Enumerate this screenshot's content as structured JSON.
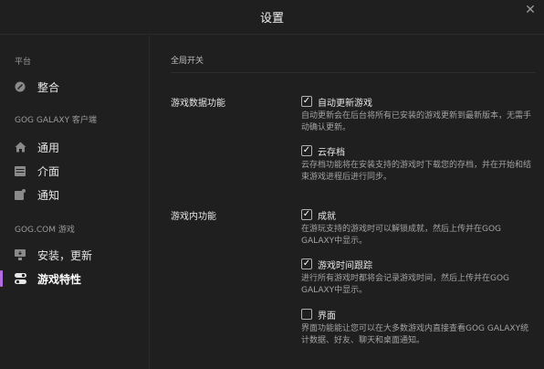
{
  "window": {
    "title": "设置",
    "close_icon": "close-icon"
  },
  "sidebar": {
    "sections": [
      {
        "header": "平台",
        "items": [
          {
            "label": "整合",
            "icon": "integration-icon"
          }
        ]
      },
      {
        "header": "GOG GALAXY 客户端",
        "items": [
          {
            "label": "通用",
            "icon": "home-icon"
          },
          {
            "label": "介面",
            "icon": "interface-icon"
          },
          {
            "label": "通知",
            "icon": "notification-icon"
          }
        ]
      },
      {
        "header": "GOG.COM 游戏",
        "items": [
          {
            "label": "安装，更新",
            "icon": "install-update-icon"
          },
          {
            "label": "游戏特性",
            "icon": "game-features-icon",
            "active": true
          }
        ]
      }
    ],
    "accent_color": "#b26be0"
  },
  "main": {
    "header": "全局开关",
    "groups": [
      {
        "label": "游戏数据功能",
        "options": [
          {
            "label": "自动更新游戏",
            "checked": true,
            "description": "自动更新会在后台将所有已安装的游戏更新到最新版本，无需手动确认更新。"
          },
          {
            "label": "云存档",
            "checked": true,
            "description": "云存档功能将在安装支持的游戏时下载您的存档，并在开始和结束游戏进程后进行同步。"
          }
        ]
      },
      {
        "label": "游戏内功能",
        "options": [
          {
            "label": "成就",
            "checked": true,
            "description": "在游玩支持的游戏时可以解锁成就，然后上传并在GOG GALAXY中显示。"
          },
          {
            "label": "游戏时间跟踪",
            "checked": true,
            "description": "进行所有游戏时都将会记录游戏时间，然后上传并在GOG GALAXY中显示。"
          },
          {
            "label": "界面",
            "checked": false,
            "description": "界面功能能让您可以在大多数游戏内直接查看GOG GALAXY统计数据、好友、聊天和桌面通知。"
          }
        ]
      }
    ]
  }
}
